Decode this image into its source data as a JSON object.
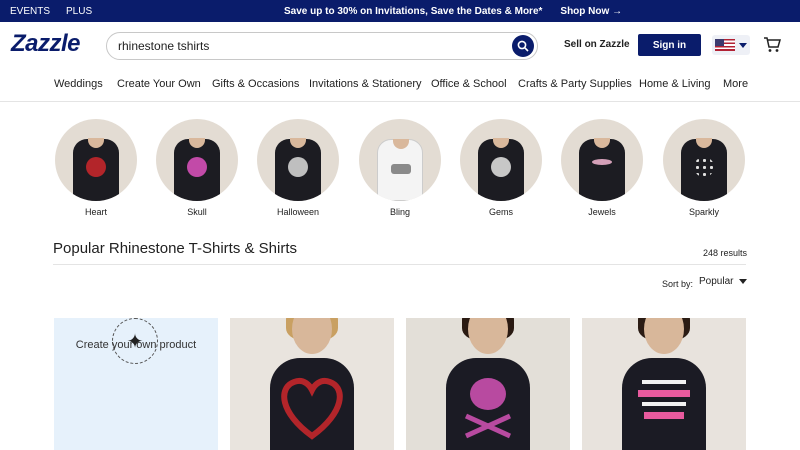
{
  "promo": {
    "links": [
      "EVENTS",
      "PLUS"
    ],
    "message": "Save up to 30% on Invitations, Save the Dates & More*",
    "cta": "Shop Now →"
  },
  "header": {
    "logo": "Zazzle",
    "search_value": "rhinestone tshirts",
    "sell": "Sell on Zazzle",
    "signin": "Sign in"
  },
  "nav": [
    "Weddings",
    "Create Your Own",
    "Gifts & Occasions",
    "Invitations & Stationery",
    "Office & School",
    "Crafts & Party Supplies",
    "Home & Living",
    "More"
  ],
  "categories": [
    {
      "label": "Heart",
      "shirt": "dark",
      "accent": "#b3252a"
    },
    {
      "label": "Skull",
      "shirt": "dark",
      "accent": "#c24aa8"
    },
    {
      "label": "Halloween",
      "shirt": "dark",
      "accent": "#bfbfbf"
    },
    {
      "label": "Bling",
      "shirt": "white",
      "accent": "#8a8a8a"
    },
    {
      "label": "Gems",
      "shirt": "dark",
      "accent": "#c7c7c7"
    },
    {
      "label": "Jewels",
      "shirt": "dark",
      "accent": "#d4a0b8"
    },
    {
      "label": "Sparkly",
      "shirt": "dark",
      "accent": "#e0e0e0"
    }
  ],
  "main": {
    "title": "Popular Rhinestone T-Shirts & Shirts",
    "results": "248 results",
    "sort_label": "Sort by:",
    "sort_value": "Popular",
    "create_text": "Create your own product"
  },
  "colors": {
    "brand": "#0a1c6b",
    "create_bg": "#e6f1fb"
  }
}
